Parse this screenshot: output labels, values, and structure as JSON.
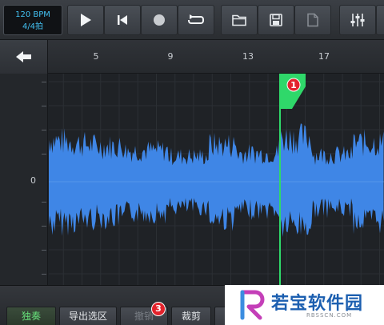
{
  "toolbar": {
    "bpm_label": "120 BPM",
    "time_signature": "4/4拍",
    "buttons": [
      "play-icon",
      "skip-to-start-icon",
      "record-icon",
      "loop-icon",
      "folder-icon",
      "save-icon",
      "new-file-icon",
      "mixer-icon"
    ]
  },
  "ruler": {
    "bars": [
      "5",
      "9",
      "13",
      "17"
    ]
  },
  "editor": {
    "y_label": "0",
    "marker_number": "1",
    "waveform_color": "#3f86e6",
    "playhead_color": "#2fd86a"
  },
  "bottom": {
    "solo_label": "独奏",
    "export_label": "导出选区",
    "undo_label": "撤销",
    "cut_label": "裁剪",
    "badge_number": "3"
  },
  "watermark": {
    "brand": "若宝软件园",
    "url": "RBSSCN.COM"
  }
}
